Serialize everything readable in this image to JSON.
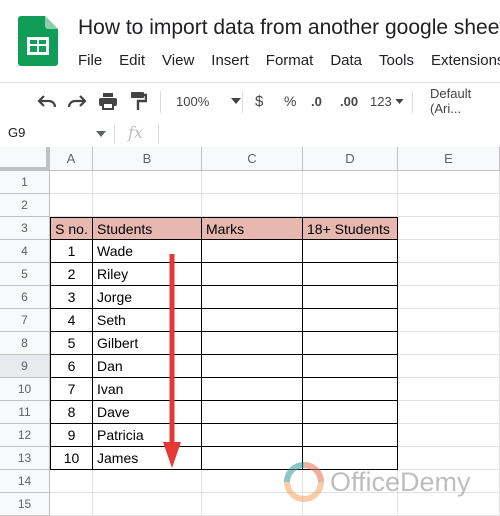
{
  "app": {
    "doc_title": "How to import data from another google sheet",
    "menu": [
      "File",
      "Edit",
      "View",
      "Insert",
      "Format",
      "Data",
      "Tools",
      "Extensions"
    ]
  },
  "toolbar": {
    "zoom": "100%",
    "currency": "$",
    "percent": "%",
    "dec_decrease": ".0",
    "dec_increase": ".00",
    "more_formats": "123",
    "font": "Default (Ari..."
  },
  "formula_bar": {
    "name_box": "G9",
    "fx": "fx"
  },
  "sheet": {
    "columns": [
      "A",
      "B",
      "C",
      "D",
      "E"
    ],
    "rows": [
      "1",
      "2",
      "3",
      "4",
      "5",
      "6",
      "7",
      "8",
      "9",
      "10",
      "11",
      "12",
      "13",
      "14",
      "15"
    ],
    "selected_row": "9",
    "table_headers": [
      "S no.",
      "Students",
      "Marks",
      "18+ Students"
    ],
    "table_rows": [
      {
        "sno": "1",
        "name": "Wade"
      },
      {
        "sno": "2",
        "name": "Riley"
      },
      {
        "sno": "3",
        "name": "Jorge"
      },
      {
        "sno": "4",
        "name": "Seth"
      },
      {
        "sno": "5",
        "name": "Gilbert"
      },
      {
        "sno": "6",
        "name": "Dan"
      },
      {
        "sno": "7",
        "name": "Ivan"
      },
      {
        "sno": "8",
        "name": "Dave"
      },
      {
        "sno": "9",
        "name": "Patricia"
      },
      {
        "sno": "10",
        "name": "James"
      }
    ],
    "header_color": "#e6b8af",
    "arrow_color": "#e53935"
  },
  "watermark": {
    "text": "OfficeDemy"
  }
}
